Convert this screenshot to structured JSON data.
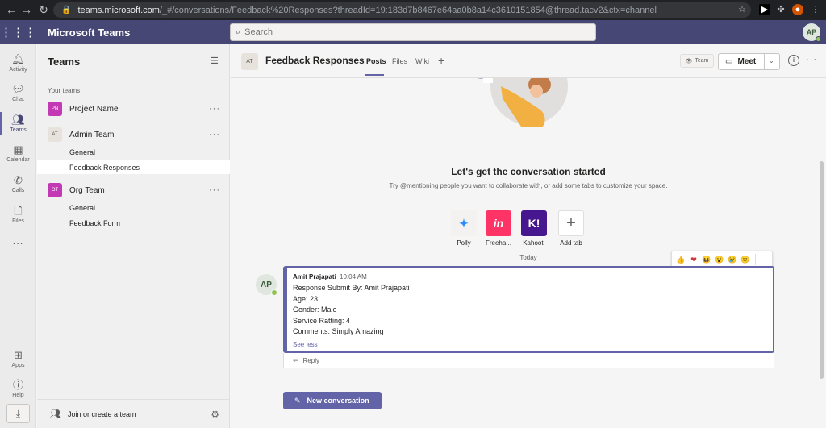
{
  "browser": {
    "url_host": "teams.microsoft.com",
    "url_path": "/_#/conversations/Feedback%20Responses?threadId=19:183d7b8467e64aa0b8a14c3610151854@thread.tacv2&ctx=channel"
  },
  "header": {
    "app_title": "Microsoft Teams",
    "search_placeholder": "Search",
    "user_initials": "AP"
  },
  "rail": {
    "items": [
      {
        "label": "Activity",
        "icon": "bell-icon"
      },
      {
        "label": "Chat",
        "icon": "chat-icon"
      },
      {
        "label": "Teams",
        "icon": "teams-icon"
      },
      {
        "label": "Calendar",
        "icon": "calendar-icon"
      },
      {
        "label": "Calls",
        "icon": "phone-icon"
      },
      {
        "label": "Files",
        "icon": "file-icon"
      }
    ],
    "more": "...",
    "bottom": [
      {
        "label": "Apps",
        "icon": "apps-icon"
      },
      {
        "label": "Help",
        "icon": "help-icon"
      }
    ]
  },
  "teams_panel": {
    "title": "Teams",
    "section_label": "Your teams",
    "teams": [
      {
        "badge": "PN",
        "name": "Project Name",
        "color": "#c239b3"
      },
      {
        "badge": "AT",
        "name": "Admin Team",
        "color": "#e8e2dd"
      },
      {
        "badge": "OT",
        "name": "Org Team",
        "color": "#c239b3"
      }
    ],
    "channels_admin": [
      "General",
      "Feedback Responses"
    ],
    "channels_org": [
      "General",
      "Feedback Form"
    ],
    "footer_label": "Join or create a team"
  },
  "channel": {
    "badge": "AT",
    "name": "Feedback Responses",
    "tabs": [
      "Posts",
      "Files",
      "Wiki"
    ],
    "team_pill": "Team",
    "meet_label": "Meet"
  },
  "conversation": {
    "title": "Let's get the conversation started",
    "subtitle": "Try @mentioning people you want to collaborate with, or add some tabs to customize your space.",
    "apps": [
      {
        "label": "Polly",
        "color": "#f3f2f1"
      },
      {
        "label": "Freeha...",
        "color": "#ff3366"
      },
      {
        "label": "Kahoot!",
        "color": "#46178f"
      },
      {
        "label": "Add tab",
        "color": "#ffffff"
      }
    ],
    "app_tile_text": {
      "freehand": "in",
      "kahoot": "K!",
      "add": "+"
    },
    "date_divider": "Today",
    "message": {
      "author": "Amit Prajapati",
      "time": "10:04 AM",
      "avatar_initials": "AP",
      "lines": [
        "Response Submit By: Amit Prajapati",
        "Age: 23",
        "Gender: Male",
        "Service Ratting: 4",
        "Comments: Simply Amazing"
      ],
      "see_less": "See less",
      "reply_label": "Reply"
    },
    "reactions": [
      "👍",
      "❤",
      "😆",
      "😮",
      "😢",
      "🙂"
    ],
    "new_conversation_label": "New conversation"
  },
  "colors": {
    "header_bg": "#464775",
    "accent": "#6264a7",
    "presence": "#92c353"
  }
}
